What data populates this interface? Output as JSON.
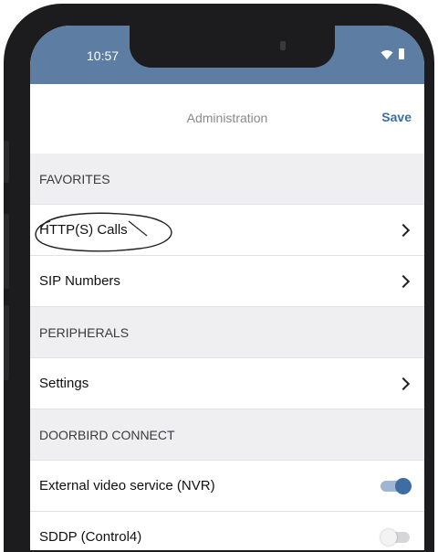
{
  "status_bar": {
    "time": "10:57",
    "icons": [
      "wifi-icon",
      "battery-icon"
    ]
  },
  "nav": {
    "title": "Administration",
    "save_label": "Save"
  },
  "sections": [
    {
      "header": "FAVORITES",
      "rows": [
        {
          "label": "HTTP(S) Calls",
          "control": "chevron"
        },
        {
          "label": "SIP Numbers",
          "control": "chevron"
        }
      ]
    },
    {
      "header": "PERIPHERALS",
      "rows": [
        {
          "label": "Settings",
          "control": "chevron"
        }
      ]
    },
    {
      "header": "DOORBIRD CONNECT",
      "rows": [
        {
          "label": "External video service (NVR)",
          "control": "toggle",
          "on": true
        },
        {
          "label": "SDDP (Control4)",
          "control": "toggle",
          "on": false
        }
      ]
    }
  ],
  "colors": {
    "status_bar": "#5d7da3",
    "accent": "#3b6ea5",
    "section_bg": "#efeff2"
  }
}
